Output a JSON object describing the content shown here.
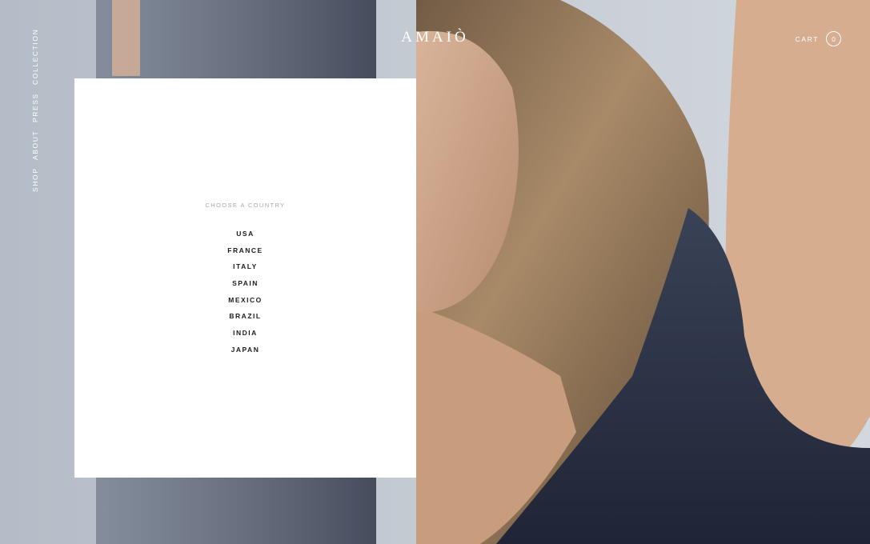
{
  "brand": {
    "logo_text": "AMAIÒ"
  },
  "nav": {
    "items": [
      {
        "label": "COLLECTION"
      },
      {
        "label": "PRESS"
      },
      {
        "label": "ABOUT"
      },
      {
        "label": "SHOP"
      }
    ]
  },
  "cart": {
    "label": "CART",
    "count": "0"
  },
  "country_selector": {
    "heading": "CHOOSE A COUNTRY",
    "countries": [
      "USA",
      "FRANCE",
      "ITALY",
      "SPAIN",
      "MEXICO",
      "BRAZIL",
      "INDIA",
      "JAPAN"
    ]
  },
  "colors": {
    "panel_bg": "#ffffff",
    "heading_text": "#a7a7a7",
    "country_text": "#1b1b1b",
    "overlay_text": "#ffffff"
  }
}
